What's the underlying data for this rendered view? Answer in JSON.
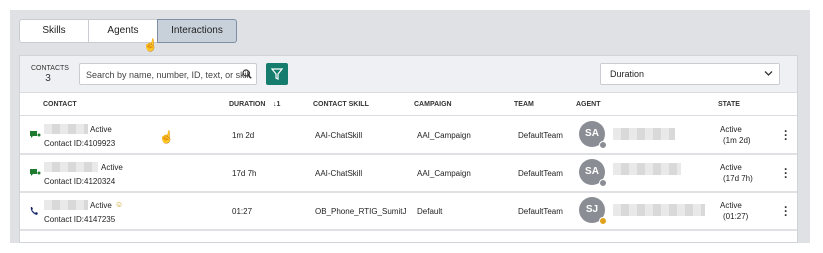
{
  "tabs": [
    {
      "label": "Skills"
    },
    {
      "label": "Agents"
    },
    {
      "label": "Interactions"
    }
  ],
  "toolbar": {
    "contacts_label": "CONTACTS",
    "contacts_count": "3",
    "search_placeholder": "Search by name, number, ID, text, or skill",
    "dropdown_value": "Duration"
  },
  "columns": {
    "contact": "CONTACT",
    "duration": "DURATION",
    "duration_sort": "↓1",
    "skill": "CONTACT SKILL",
    "campaign": "CAMPAIGN",
    "team": "TEAM",
    "agent": "AGENT",
    "state": "STATE"
  },
  "rows": [
    {
      "type": "chat",
      "status": "Active",
      "contact_id": "Contact ID:4109923",
      "duration": "1m 2d",
      "skill": "AAI-ChatSkill",
      "campaign": "AAI_Campaign",
      "team": "DefaultTeam",
      "agent_initials": "SA",
      "state": "Active",
      "state_detail": "(1m 2d)",
      "dot_color": "#8a8e94"
    },
    {
      "type": "chat",
      "status": "Active",
      "contact_id": "Contact ID:4120324",
      "duration": "17d 7h",
      "skill": "AAI-ChatSkill",
      "campaign": "AAI_Campaign",
      "team": "DefaultTeam",
      "agent_initials": "SA",
      "state": "Active",
      "state_detail": "(17d 7h)",
      "dot_color": "#8a8e94"
    },
    {
      "type": "phone",
      "status": "Active",
      "contact_id": "Contact ID:4147235",
      "duration": "01:27",
      "skill": "OB_Phone_RTIG_SumitJ",
      "campaign": "Default",
      "team": "DefaultTeam",
      "agent_initials": "SJ",
      "state": "Active",
      "state_detail": "(01:27)",
      "dot_color": "#e0a21a"
    }
  ],
  "colors": {
    "accent": "#167d6e",
    "active_tab": "#c8d0da"
  }
}
